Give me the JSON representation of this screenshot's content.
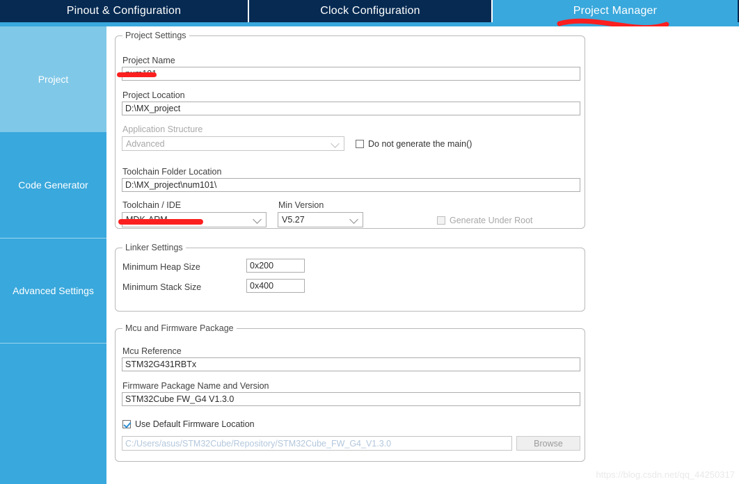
{
  "tabs": [
    {
      "id": "pinout",
      "label": "Pinout & Configuration",
      "active": false
    },
    {
      "id": "clock",
      "label": "Clock Configuration",
      "active": false
    },
    {
      "id": "project-manager",
      "label": "Project Manager",
      "active": true
    }
  ],
  "sidebar": {
    "items": [
      {
        "id": "project",
        "label": "Project",
        "active": true
      },
      {
        "id": "code-generator",
        "label": "Code Generator",
        "active": false
      },
      {
        "id": "advanced-settings",
        "label": "Advanced Settings",
        "active": false
      },
      {
        "id": "blank",
        "label": "",
        "active": false
      }
    ]
  },
  "project_settings": {
    "group_title": "Project Settings",
    "project_name_label": "Project Name",
    "project_name_value": "num101",
    "project_location_label": "Project Location",
    "project_location_value": "D:\\MX_project",
    "application_structure_label": "Application Structure",
    "application_structure_value": "Advanced",
    "do_not_generate_main_label": "Do not generate the main()",
    "do_not_generate_main_checked": false,
    "toolchain_folder_label": "Toolchain Folder Location",
    "toolchain_folder_value": "D:\\MX_project\\num101\\",
    "toolchain_ide_label": "Toolchain / IDE",
    "toolchain_ide_value": "MDK-ARM",
    "min_version_label": "Min Version",
    "min_version_value": "V5.27",
    "generate_under_root_label": "Generate Under Root",
    "generate_under_root_checked": false
  },
  "linker_settings": {
    "group_title": "Linker Settings",
    "min_heap_label": "Minimum Heap Size",
    "min_heap_value": "0x200",
    "min_stack_label": "Minimum Stack Size",
    "min_stack_value": "0x400"
  },
  "mcu_firmware": {
    "group_title": "Mcu and Firmware Package",
    "mcu_reference_label": "Mcu Reference",
    "mcu_reference_value": "STM32G431RBTx",
    "firmware_package_label": "Firmware Package Name and Version",
    "firmware_package_value": "STM32Cube FW_G4 V1.3.0",
    "use_default_location_label": "Use Default Firmware Location",
    "use_default_location_checked": true,
    "firmware_path_value": "C:/Users/asus/STM32Cube/Repository/STM32Cube_FW_G4_V1.3.0",
    "browse_label": "Browse"
  },
  "watermark": {
    "text": "https://blog.csdn.net/qq_44250317"
  },
  "colors": {
    "tab_inactive_bg": "#062a52",
    "tab_active_bg": "#39a8dc",
    "sidebar_bg": "#39a8dc",
    "sidebar_active_bg": "#80c8e8",
    "annotation_red": "#fb1f1f"
  }
}
